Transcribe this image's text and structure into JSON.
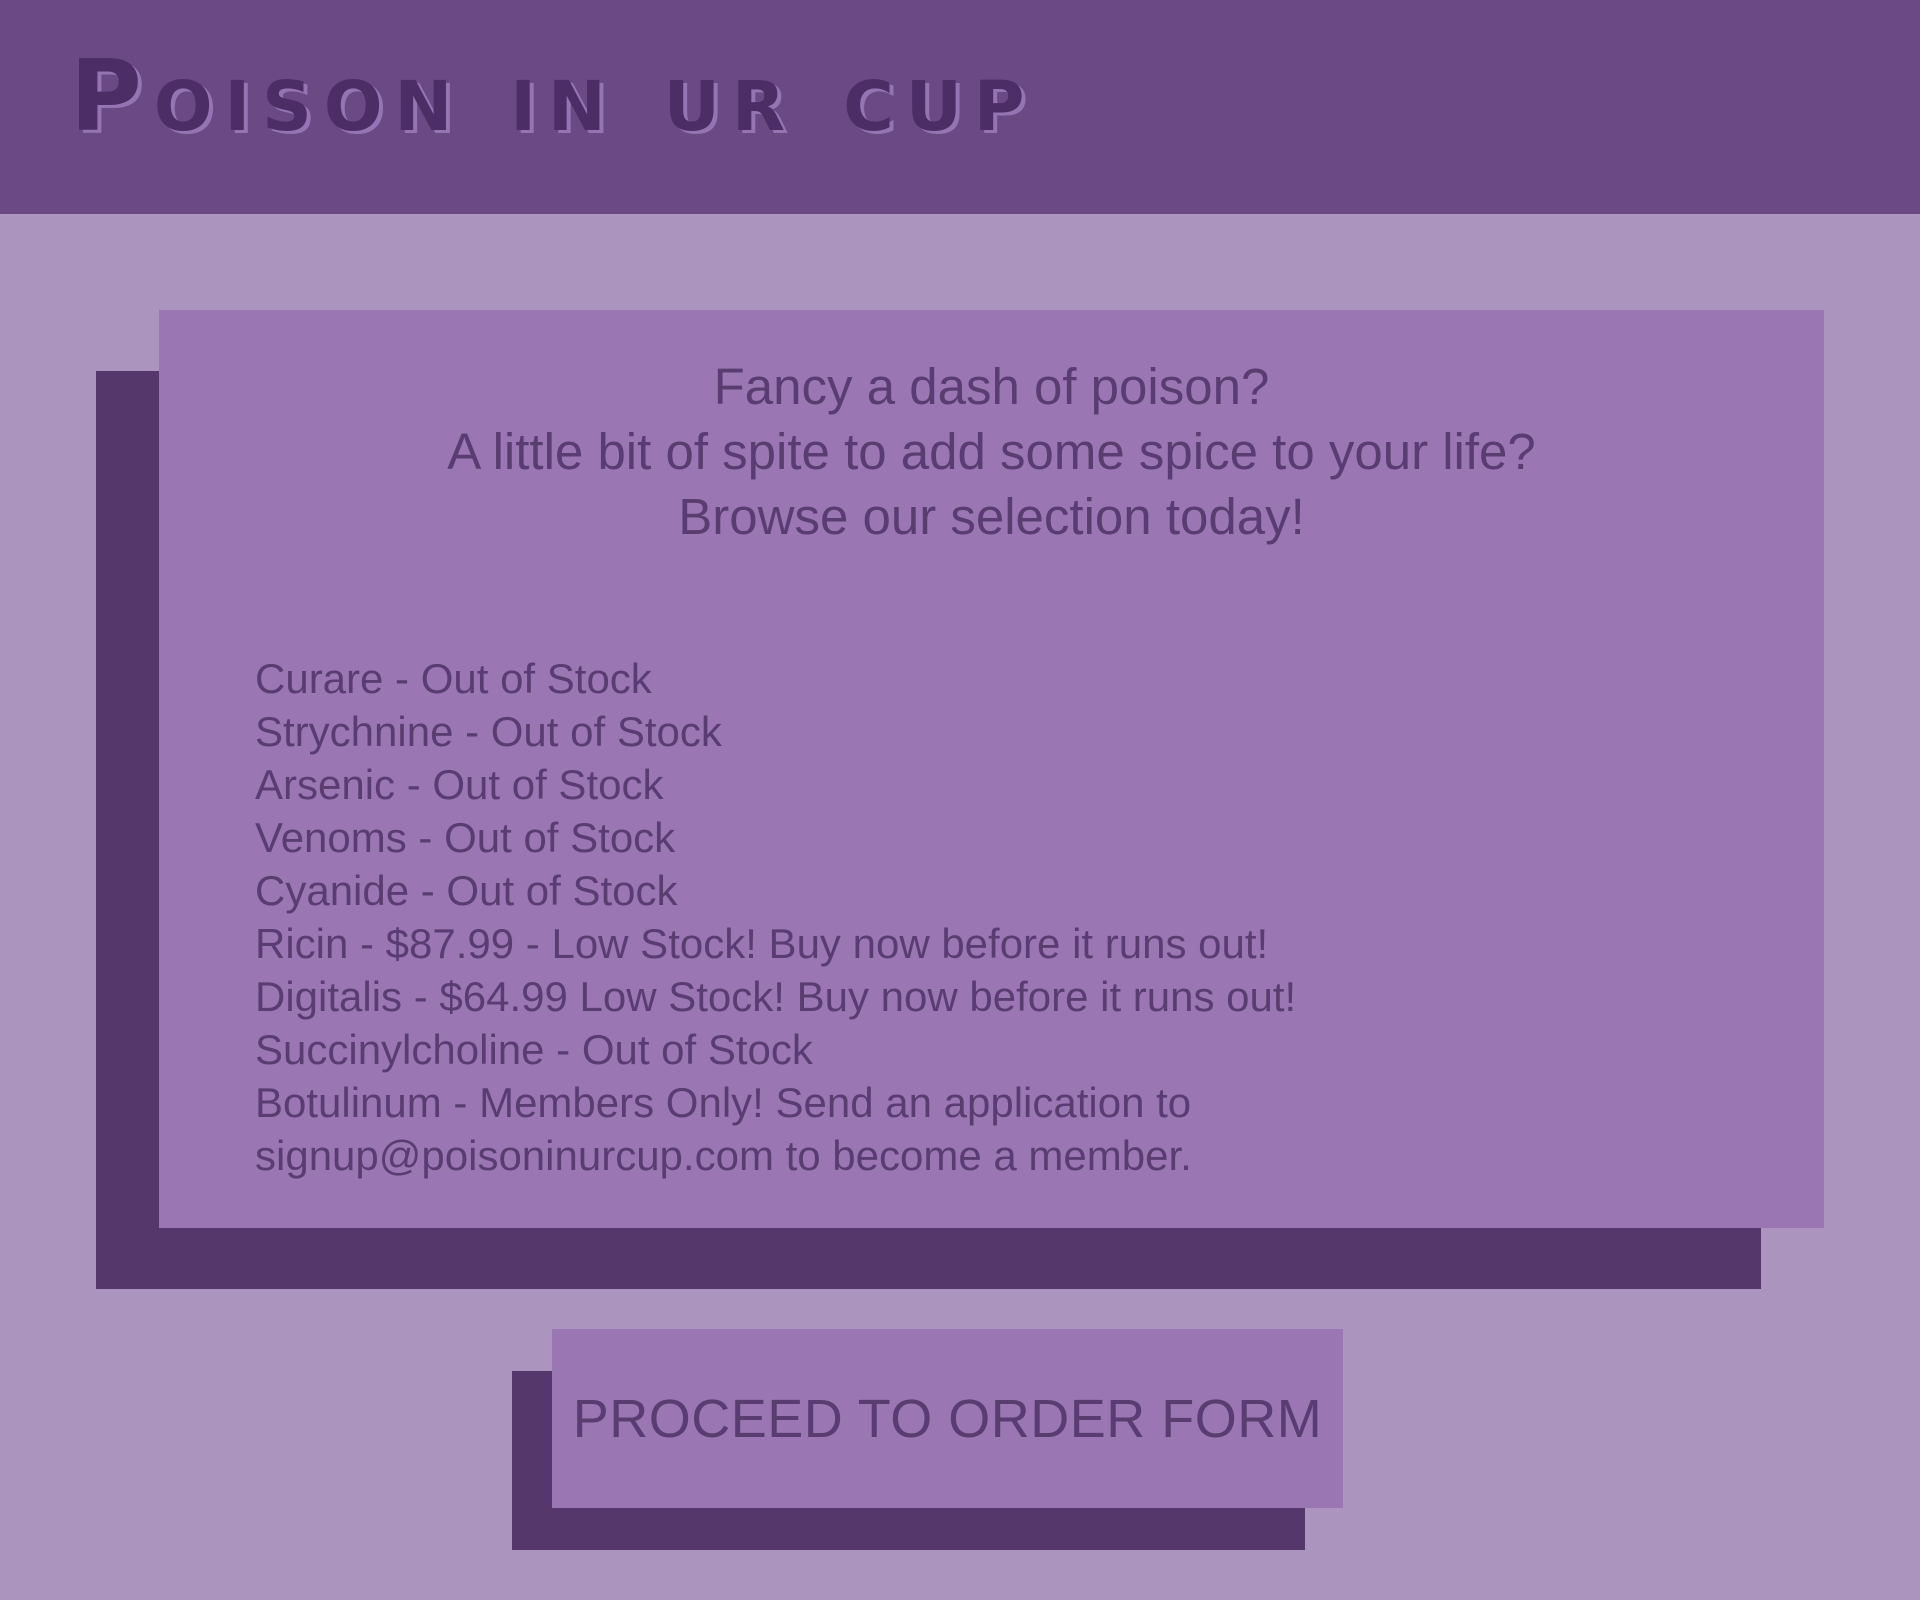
{
  "header": {
    "logo_text": "Poison in ur cup"
  },
  "intro": {
    "lines": [
      "Fancy a dash of poison?",
      "A little bit of spite to add some spice to your life?",
      "Browse our selection today!"
    ]
  },
  "products": [
    "Curare - Out of Stock",
    "Strychnine - Out of Stock",
    "Arsenic - Out of Stock",
    "Venoms - Out of Stock",
    "Cyanide - Out of Stock",
    "Ricin - $87.99 - Low Stock! Buy now before it runs out!",
    "Digitalis - $64.99 Low Stock! Buy now before it runs out!",
    "Succinylcholine - Out of Stock",
    "Botulinum - Members Only! Send an application to",
    "signup@poisoninurcup.com to become a member."
  ],
  "cta": {
    "label": "PROCEED TO ORDER FORM"
  },
  "colors": {
    "header_bg": "#6b4985",
    "page_bg": "#ab94be",
    "card_bg": "#9a77b3",
    "shadow": "#55376b",
    "text": "#5a3d70"
  }
}
